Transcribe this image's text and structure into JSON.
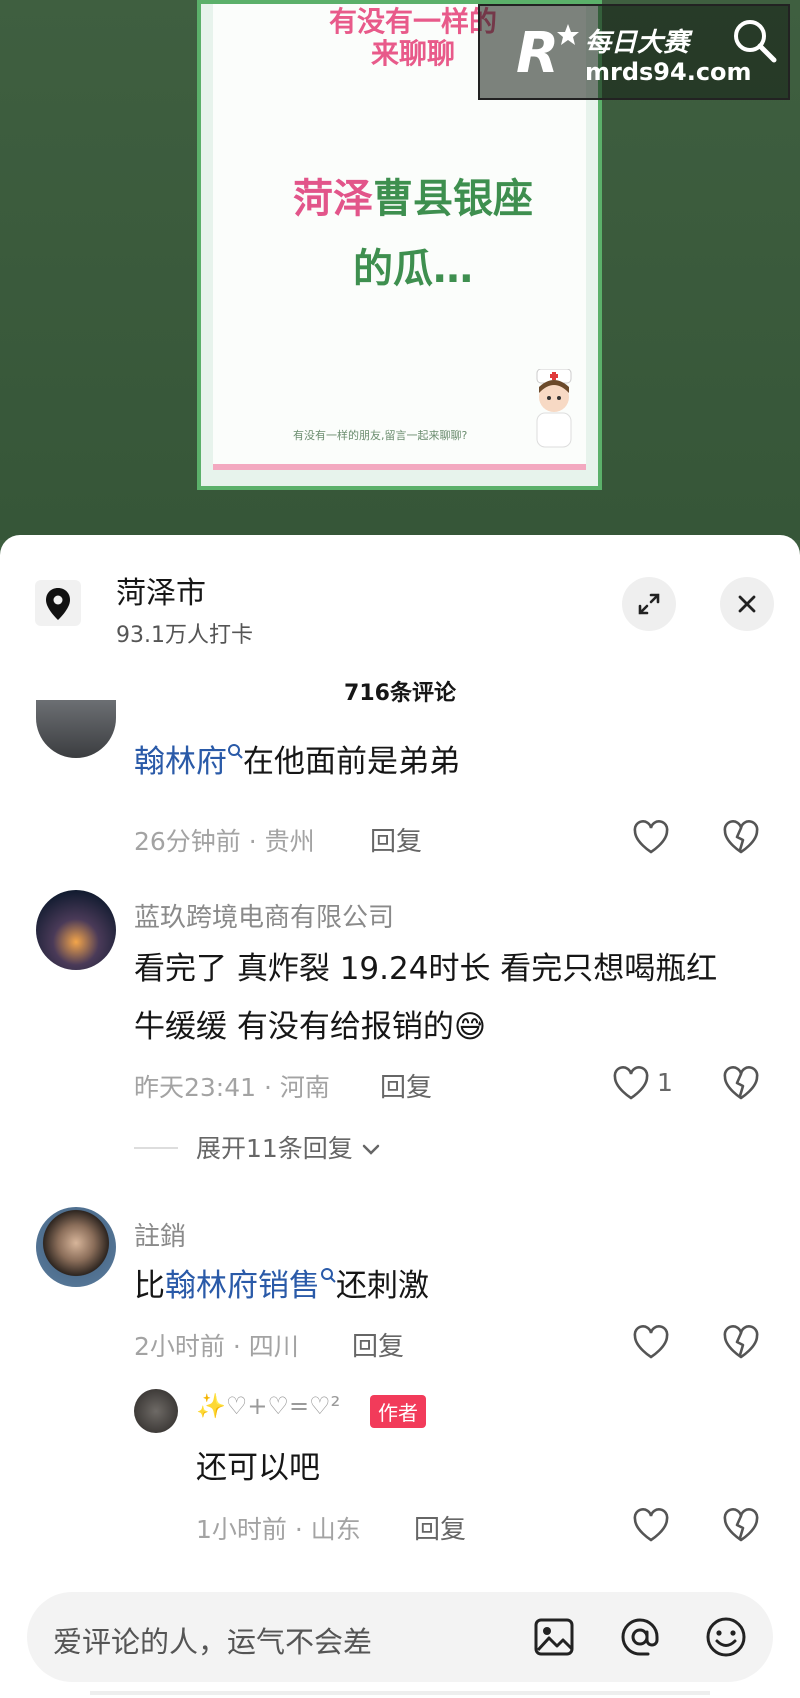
{
  "video": {
    "poster_banner_line1": "有没有一样的",
    "poster_banner_line2": "来聊聊",
    "poster_title_pink": "菏泽",
    "poster_title_green": "曹县银座",
    "poster_title_line2": "的瓜…",
    "poster_footer": "有没有一样的朋友,留言一起来聊聊?",
    "watermark_name": "每日大赛",
    "watermark_url": "mrds94.com",
    "watermark_logo_letter": "R"
  },
  "location": {
    "name": "菏泽市",
    "subtitle": "93.1万人打卡",
    "icon": "location-pin-icon"
  },
  "header": {
    "comment_count": "716条评论",
    "expand_icon": "expand-icon",
    "close_icon": "close-icon"
  },
  "comments": [
    {
      "username": "",
      "text_link": "翰林府",
      "text_rest": "在他面前是弟弟",
      "meta": "26分钟前 · 贵州",
      "reply_label": "回复",
      "likes": ""
    },
    {
      "username": "蓝玖跨境电商有限公司",
      "text_line1": "看完了 真炸裂 19.24时长 看完只想喝瓶红",
      "text_line2": "牛缓缓 有没有给报销的",
      "emoji": "😅",
      "meta": "昨天23:41 · 河南",
      "reply_label": "回复",
      "likes": "1",
      "expand_label": "展开11条回复"
    },
    {
      "username": "註銷",
      "text_prefix": "比",
      "text_link": "翰林府销售",
      "text_rest": "还刺激",
      "meta": "2小时前 · 四川",
      "reply_label": "回复",
      "likes": ""
    }
  ],
  "reply": {
    "username": "✨♡+♡=♡²",
    "badge": "作者",
    "text": "还可以吧",
    "meta": "1小时前 · 山东",
    "reply_label": "回复"
  },
  "input": {
    "placeholder": "爱评论的人，运气不会差",
    "icons": [
      "image-icon",
      "at-icon",
      "emoji-icon"
    ]
  },
  "colors": {
    "link": "#2a5aa8",
    "badge": "#f23b5a",
    "poster_green": "#3e8f4f",
    "poster_pink": "#e2558a"
  }
}
